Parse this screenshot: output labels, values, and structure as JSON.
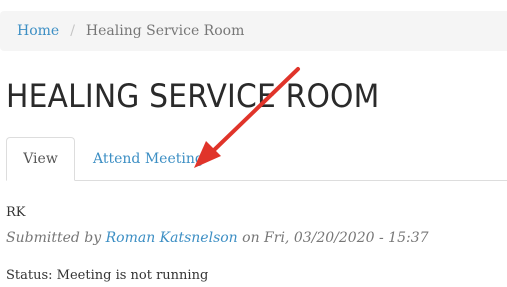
{
  "breadcrumb": {
    "home": "Home",
    "separator": "/",
    "current": "Healing Service Room"
  },
  "page": {
    "title": "HEALING SERVICE ROOM"
  },
  "tabs": [
    {
      "label": "View",
      "active": true
    },
    {
      "label": "Attend Meeting",
      "active": false
    }
  ],
  "content": {
    "title": "RK",
    "submitted_prefix": "Submitted by",
    "author": "Roman Katsnelson",
    "submitted_suffix": "on Fri, 03/20/2020 - 15:37",
    "status": "Status: Meeting is not running"
  },
  "colors": {
    "link": "#3d8fc4",
    "annotation_arrow": "#e0342a"
  },
  "icons": {
    "annotation": "red-arrow-pointing-to-attend-meeting"
  }
}
